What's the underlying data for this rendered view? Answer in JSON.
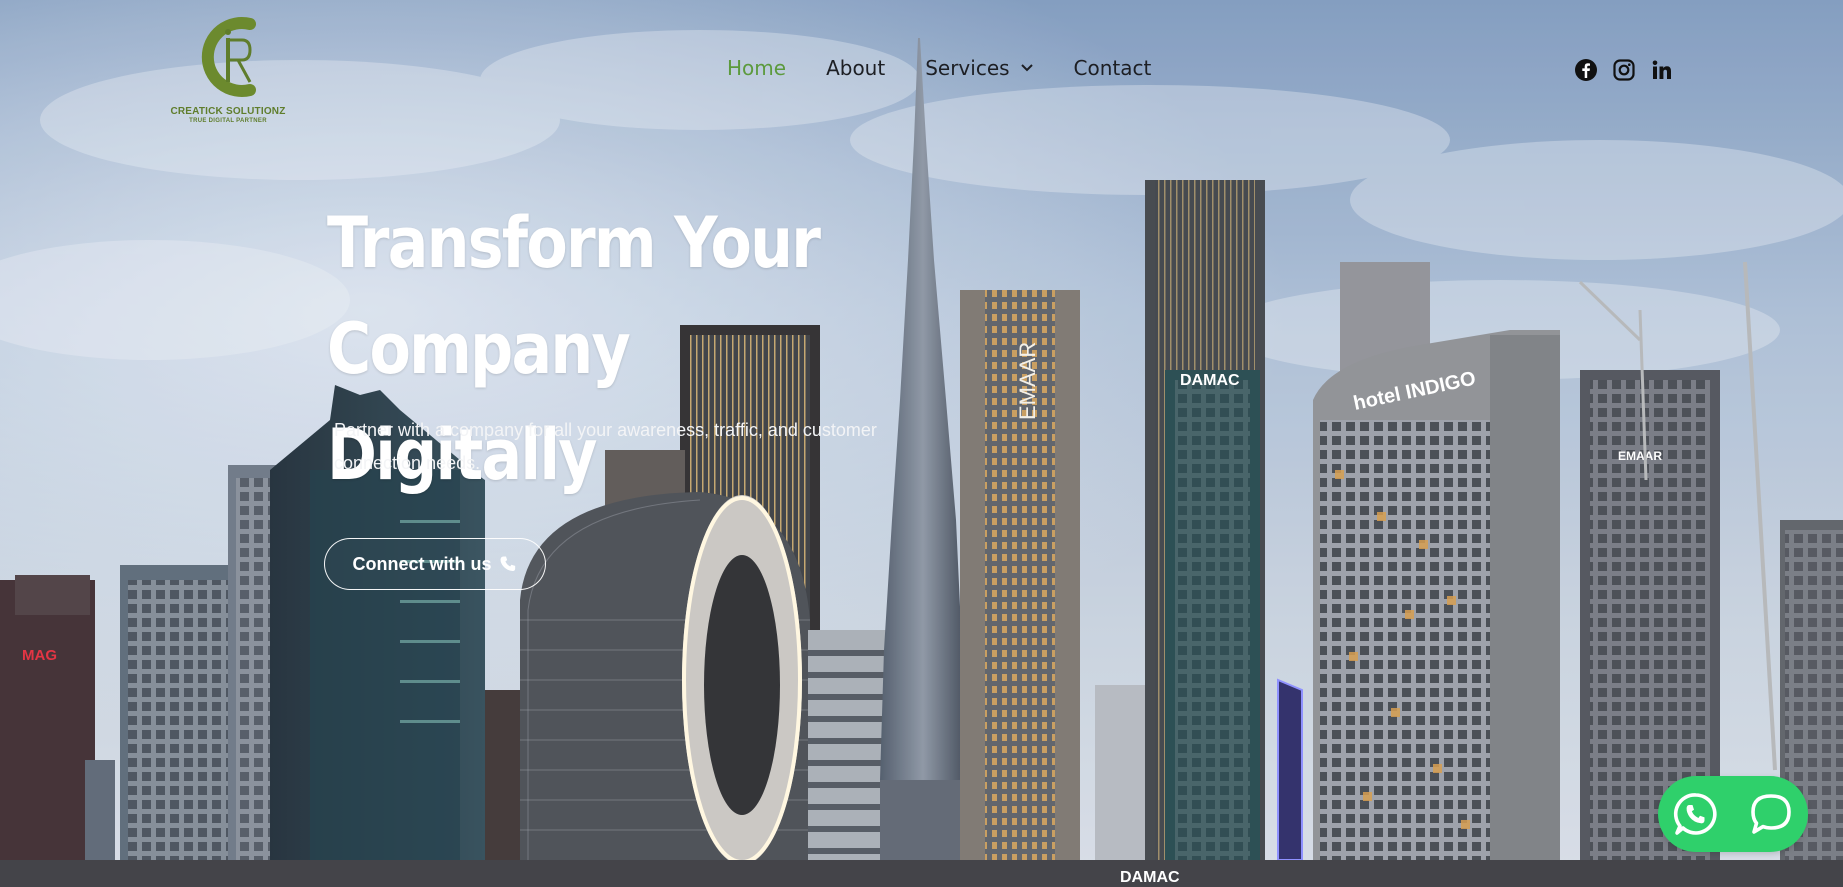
{
  "brand": {
    "name": "CREATICK SOLUTIONZ",
    "tagline": "TRUE DIGITAL PARTNER",
    "color": "#5f7d2c"
  },
  "nav": {
    "items": [
      {
        "label": "Home",
        "active": true
      },
      {
        "label": "About",
        "active": false
      },
      {
        "label": "Services",
        "active": false,
        "has_dropdown": true
      },
      {
        "label": "Contact",
        "active": false
      }
    ],
    "active_color": "#5c9a3d"
  },
  "social": [
    "facebook-icon",
    "instagram-icon",
    "linkedin-icon"
  ],
  "hero": {
    "headline_line1": "Transform Your",
    "headline_line2": "Company Digitally",
    "subtext_line1": "Partner with a company for all your awareness, traffic, and customer",
    "subtext_line2": "connection needs.",
    "cta_label": "Connect with us"
  },
  "chat_widget": {
    "icons": [
      "whatsapp-icon",
      "chat-bubble-icon"
    ],
    "color": "#2fd06b"
  },
  "skyline_signs": {
    "mag": "MAG",
    "emaar_tower": "EMAAR",
    "emaar_small": "EMAAR",
    "damac_top": "DAMAC",
    "hotel_indigo": "hotel INDIGO",
    "damac_bottom": "DAMAC"
  }
}
